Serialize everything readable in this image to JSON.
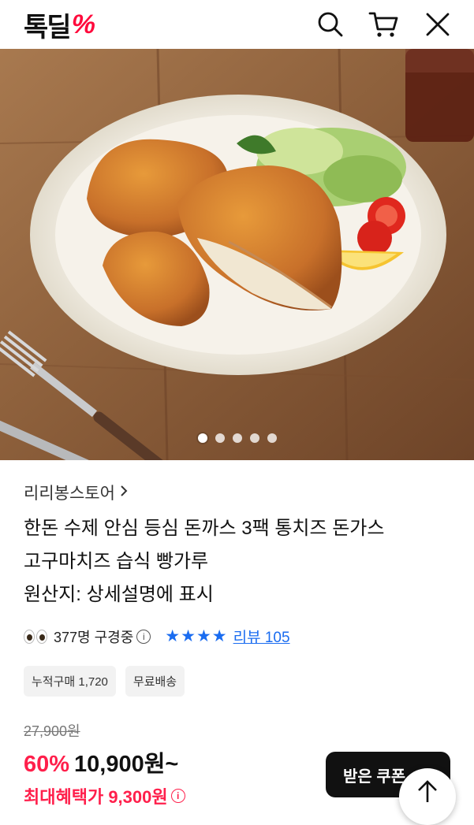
{
  "header": {
    "logo_text": "톡딜",
    "logo_mark": "%",
    "icons": [
      "search-icon",
      "cart-icon",
      "close-icon"
    ]
  },
  "gallery": {
    "slide_count": 5,
    "active_index": 0
  },
  "product": {
    "store_name": "리리봉스토어",
    "title": "한돈 수제 안심 등심 돈까스 3팩 통치즈 돈가스\n고구마치즈 습식 빵가루\n원산지: 상세설명에 표시",
    "viewers": "377명 구경중",
    "rating_stars": 4,
    "review_label": "리뷰 105",
    "badges": [
      "누적구매 1,720",
      "무료배송"
    ],
    "original_price": "27,900원",
    "discount": "60%",
    "price": "10,900원~",
    "best_price": "최대혜택가 9,300원"
  },
  "coupon_button": "받은 쿠폰",
  "colors": {
    "accent": "#ff1f4b",
    "link": "#1a6cf0"
  }
}
